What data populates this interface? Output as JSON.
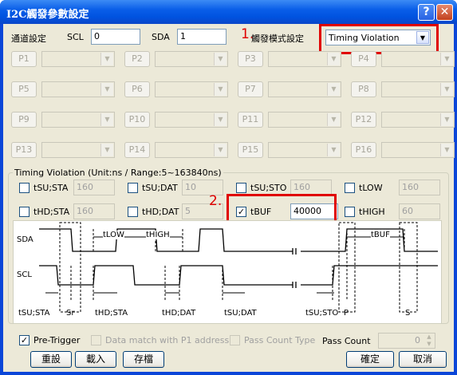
{
  "window": {
    "title": "I2C觸發參數設定"
  },
  "top": {
    "channel_label": "通道設定",
    "scl_label": "SCL",
    "scl_value": "0",
    "sda_label": "SDA",
    "sda_value": "1",
    "trigger_mode_label": "觸發模式設定",
    "trigger_mode_value": "Timing Violation"
  },
  "annotations": {
    "step1": "1.",
    "step2": "2."
  },
  "pins": [
    "P1",
    "P2",
    "P3",
    "P4",
    "P5",
    "P6",
    "P7",
    "P8",
    "P9",
    "P10",
    "P11",
    "P12",
    "P13",
    "P14",
    "P15",
    "P16"
  ],
  "timing": {
    "group_label": "Timing Violation (Unit:ns / Range:5~163840ns)",
    "items": [
      {
        "label": "tSU;STA",
        "value": "160",
        "checked": false
      },
      {
        "label": "tSU;DAT",
        "value": "10",
        "checked": false
      },
      {
        "label": "tSU;STO",
        "value": "160",
        "checked": false
      },
      {
        "label": "tLOW",
        "value": "160",
        "checked": false
      },
      {
        "label": "tHD;STA",
        "value": "160",
        "checked": false
      },
      {
        "label": "tHD;DAT",
        "value": "5",
        "checked": false
      },
      {
        "label": "tBUF",
        "value": "40000",
        "checked": true
      },
      {
        "label": "tHIGH",
        "value": "60",
        "checked": false
      }
    ]
  },
  "diagram": {
    "sda": "SDA",
    "scl": "SCL",
    "tlow": "tLOW",
    "thigh": "tHIGH",
    "tbuf": "tBUF",
    "tsusta": "tSU;STA",
    "sr": "Sr",
    "thdsta": "tHD;STA",
    "thddat": "tHD;DAT",
    "tsudat": "tSU;DAT",
    "tsusto": "tSU;STO",
    "p": "P",
    "s": "S"
  },
  "bottom": {
    "pretrigger_label": "Pre-Trigger",
    "datamatch_label": "Data match with P1 address",
    "passcounttype_label": "Pass Count Type",
    "passcount_label": "Pass Count",
    "passcount_value": "0",
    "reset_label": "重設",
    "load_label": "載入",
    "save_label": "存檔",
    "ok_label": "確定",
    "cancel_label": "取消"
  }
}
